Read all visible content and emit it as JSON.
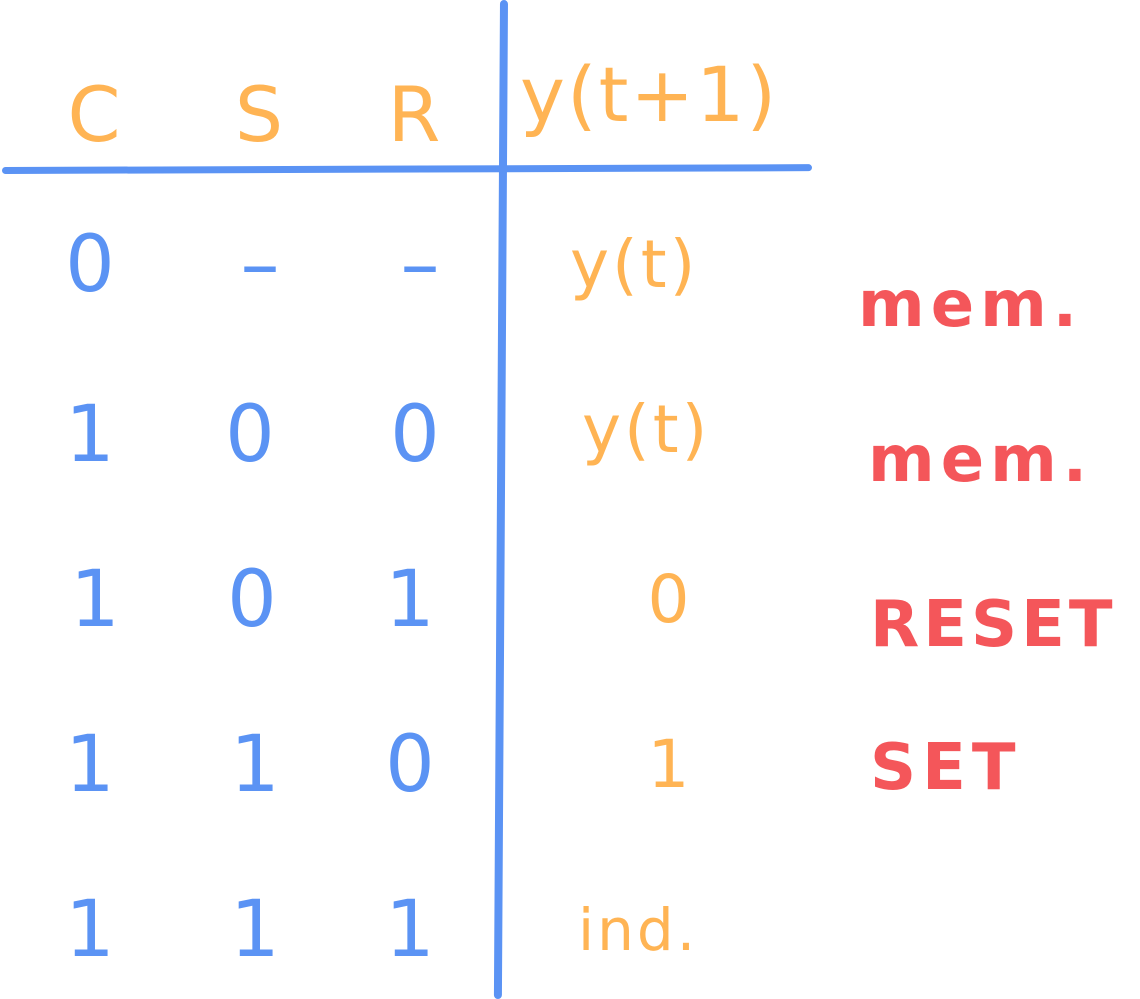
{
  "colors": {
    "line": "#5b93f4",
    "inputs": "#5b93f4",
    "outputs": "#ffb454",
    "notes": "#f4565a"
  },
  "table": {
    "headers": {
      "c": "C",
      "s": "S",
      "r": "R",
      "y": "y(t+1)"
    },
    "rows": [
      {
        "c": "0",
        "s": "–",
        "r": "–",
        "y": "y(t)",
        "note": "mem."
      },
      {
        "c": "1",
        "s": "0",
        "r": "0",
        "y": "y(t)",
        "note": "mem."
      },
      {
        "c": "1",
        "s": "0",
        "r": "1",
        "y": "0",
        "note": "RESET"
      },
      {
        "c": "1",
        "s": "1",
        "r": "0",
        "y": "1",
        "note": "SET"
      },
      {
        "c": "1",
        "s": "1",
        "r": "1",
        "y": "ind.",
        "note": ""
      }
    ]
  }
}
